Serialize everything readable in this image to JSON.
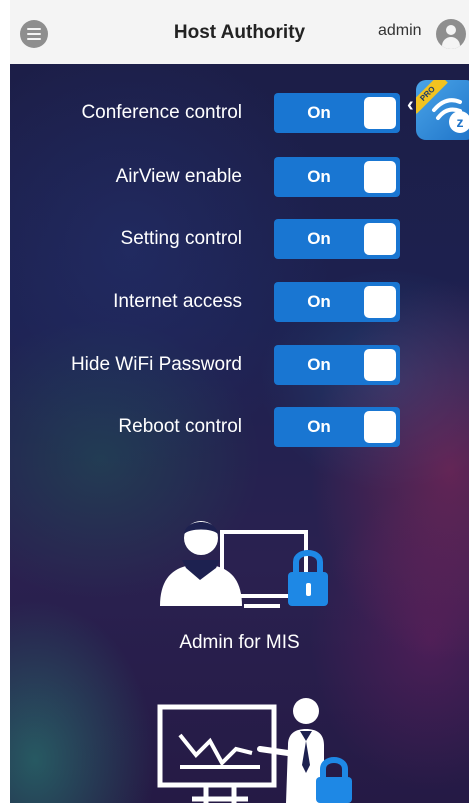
{
  "header": {
    "title": "Host Authority",
    "user": "admin",
    "menu_icon": "menu-icon",
    "avatar_icon": "user-avatar-icon"
  },
  "settings": [
    {
      "label": "Conference control",
      "state": "On"
    },
    {
      "label": "AirView enable",
      "state": "On"
    },
    {
      "label": "Setting control",
      "state": "On"
    },
    {
      "label": "Internet access",
      "state": "On"
    },
    {
      "label": "Hide WiFi Password",
      "state": "On"
    },
    {
      "label": "Reboot control",
      "state": "On"
    }
  ],
  "side_panel": {
    "handle": "‹",
    "badge": "PRO",
    "app_icon": "ezcast-app-icon"
  },
  "roles": {
    "admin_caption": "Admin for MIS",
    "admin_icon": "admin-mis-icon",
    "teacher_icon": "presenter-icon"
  },
  "colors": {
    "toggle_on": "#1976d2",
    "header_bg": "#f4f4f4",
    "background": "#1d2150",
    "lock": "#1e88e5"
  }
}
